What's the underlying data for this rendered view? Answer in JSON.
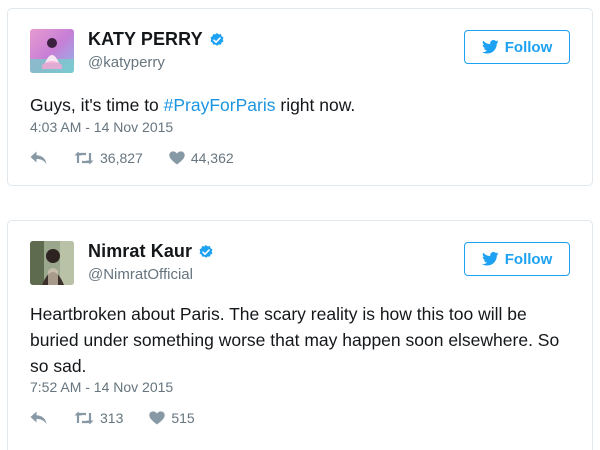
{
  "tweets": [
    {
      "display_name": "KATY PERRY",
      "handle": "@katyperry",
      "text_before": "Guys, it's time to ",
      "hashtag": "#PrayForParis",
      "text_after": " right now.",
      "timestamp": "4:03 AM - 14 Nov 2015",
      "retweets": "36,827",
      "likes": "44,362",
      "follow_label": "Follow",
      "avatar_icon": "avatar-photo-icon",
      "verified_icon": "verified-badge-icon"
    },
    {
      "display_name": "Nimrat Kaur",
      "handle": "@NimratOfficial",
      "text": "Heartbroken about Paris. The scary reality is how this too will be buried under something worse that may happen soon elsewhere. So so sad.",
      "timestamp": "7:52 AM - 14 Nov 2015",
      "retweets": "313",
      "likes": "515",
      "follow_label": "Follow",
      "avatar_icon": "avatar-photo-icon",
      "verified_icon": "verified-badge-icon"
    }
  ],
  "colors": {
    "accent": "#1da1f2",
    "hashtag": "#1b95e0",
    "muted": "#66757f",
    "icon": "#8899a6",
    "border": "#e1e8ed"
  }
}
